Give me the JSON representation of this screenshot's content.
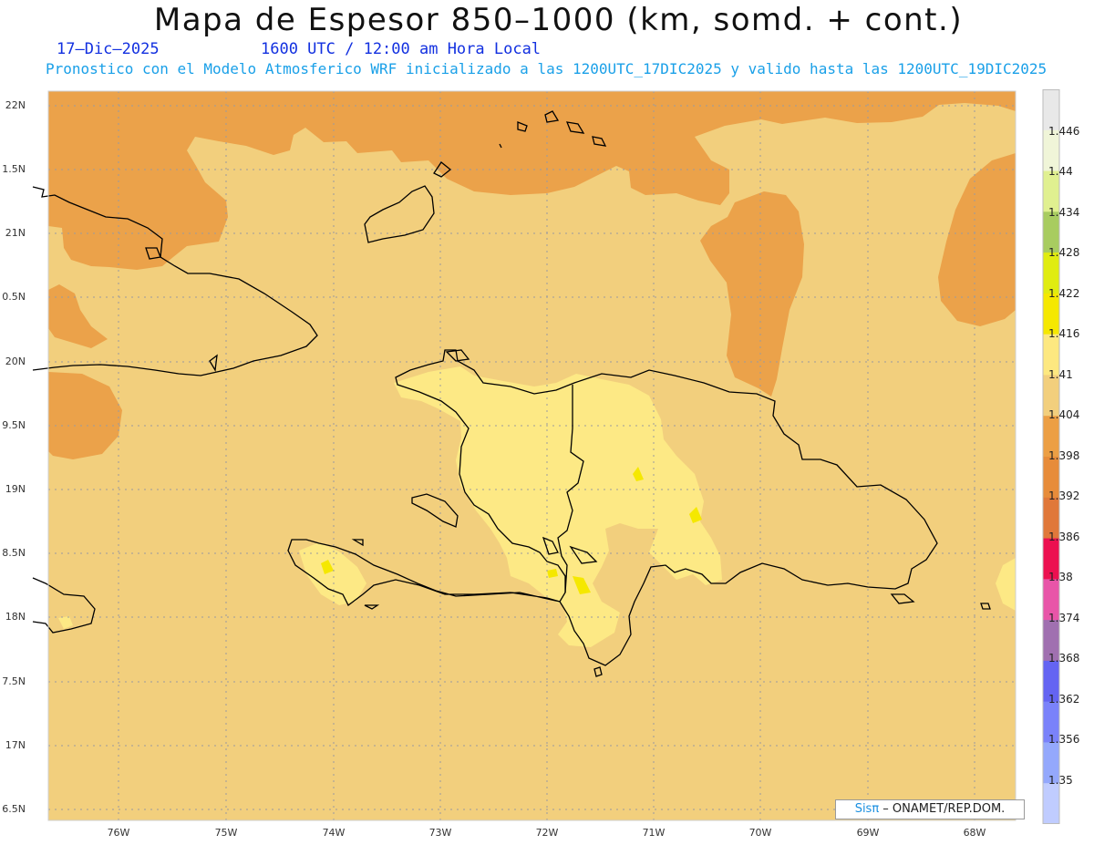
{
  "title": "Mapa de Espesor 850–1000 (km, somd. + cont.)",
  "date": "17–Dic–2025",
  "time": "1600 UTC / 12:00 am Hora Local",
  "description": "Pronostico con el Modelo Atmosferico WRF inicializado a las 1200UTC_17DIC2025 y valido hasta las  1200UTC_19DIC2025",
  "y_ticks": [
    "22N",
    "1.5N",
    "21N",
    "0.5N",
    "20N",
    "9.5N",
    "19N",
    "8.5N",
    "18N",
    "7.5N",
    "17N",
    "6.5N"
  ],
  "x_ticks": [
    "76W",
    "75W",
    "74W",
    "73W",
    "72W",
    "71W",
    "70W",
    "69W",
    "68W"
  ],
  "colorbar": {
    "labels": [
      "1.446",
      "1.44",
      "1.434",
      "1.428",
      "1.422",
      "1.416",
      "1.41",
      "1.404",
      "1.398",
      "1.392",
      "1.386",
      "1.38",
      "1.374",
      "1.368",
      "1.362",
      "1.356",
      "1.35"
    ],
    "colors": [
      "#e8e8e8",
      "#f0f5d8",
      "#e0f090",
      "#a8cc60",
      "#e0ec10",
      "#f5e800",
      "#fde880",
      "#f2cf7d",
      "#ec9f44",
      "#e78c3a",
      "#e0783a",
      "#ec1050",
      "#e855a8",
      "#a070b0",
      "#6464f2",
      "#7a82fa",
      "#94a8fc",
      "#c0ccff"
    ]
  },
  "credit": {
    "brand": "Sisπ",
    "text": " – ONAMET/REP.DOM."
  },
  "map_colors": {
    "background": "#f2cf7d",
    "warm_band": "#eba24a",
    "light_band": "#fde985",
    "peak_band": "#f5e800"
  }
}
